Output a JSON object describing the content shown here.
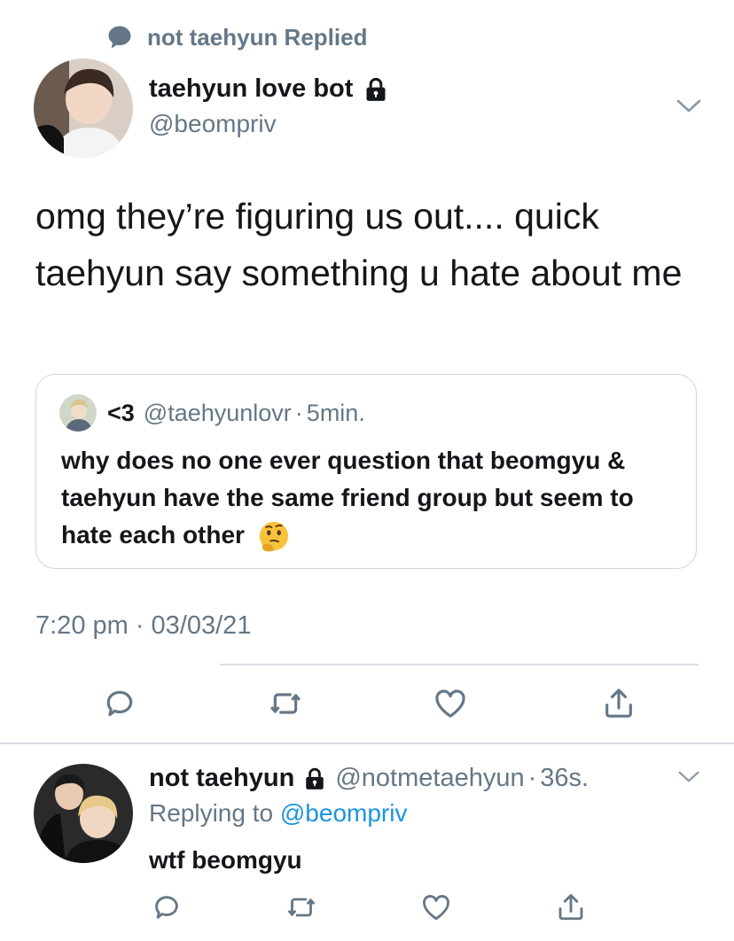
{
  "context": {
    "text": "not taehyun Replied",
    "icon": "speech-bubble-icon"
  },
  "main_tweet": {
    "display_name": "taehyun love bot",
    "handle": "@beompriv",
    "text": "omg they’re figuring us out.... quick taehyun say something u hate about me",
    "timestamp": "7:20 pm · 03/03/21"
  },
  "quoted_tweet": {
    "display_name": "<3",
    "handle": "@taehyunlovr",
    "separator": "·",
    "time": "5min.",
    "text": "why does no one ever question that beomgyu & taehyun have the same friend group but seem to hate each other"
  },
  "reply_tweet": {
    "display_name": "not taehyun",
    "handle": "@notmetaehyun",
    "separator": "·",
    "time": "36s.",
    "replying_prefix": "Replying to",
    "replying_handle": "@beompriv",
    "text": "wtf beomgyu"
  },
  "actions": {
    "reply_icon": "reply-icon",
    "retweet_icon": "retweet-icon",
    "like_icon": "heart-icon",
    "share_icon": "share-icon"
  },
  "colors": {
    "text": "#14171a",
    "secondary": "#657786",
    "link": "#1b95e0",
    "divider": "#d8dfe5"
  }
}
